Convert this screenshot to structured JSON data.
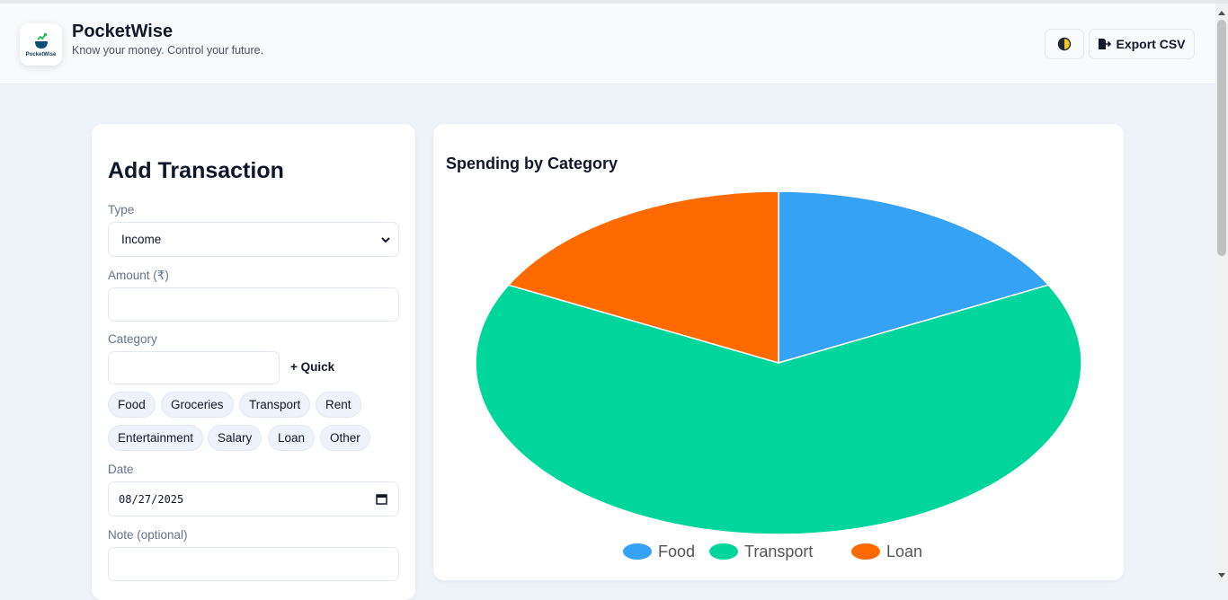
{
  "header": {
    "brand_title": "PocketWise",
    "tagline": "Know your money. Control your future.",
    "logo_text": "PocketWise",
    "export_label": "Export CSV",
    "theme_icon": "half-moon-icon",
    "export_icon": "file-export-icon"
  },
  "form": {
    "title": "Add Transaction",
    "type_label": "Type",
    "type_value": "Income",
    "amount_label": "Amount (₹)",
    "amount_value": "",
    "category_label": "Category",
    "category_value": "",
    "quick_label": "+ Quick",
    "chips": [
      "Food",
      "Groceries",
      "Transport",
      "Rent",
      "Entertainment",
      "Salary",
      "Loan",
      "Other"
    ],
    "date_label": "Date",
    "date_value": "08/27/2025",
    "note_label": "Note (optional)",
    "note_value": ""
  },
  "chart_data": {
    "type": "pie",
    "title": "Spending by Category",
    "categories": [
      "Food",
      "Transport",
      "Loan"
    ],
    "values": [
      17.5,
      65,
      17.5
    ],
    "colors": [
      "#36a2f5",
      "#00d59c",
      "#ff6a00"
    ],
    "legend_position": "bottom"
  }
}
